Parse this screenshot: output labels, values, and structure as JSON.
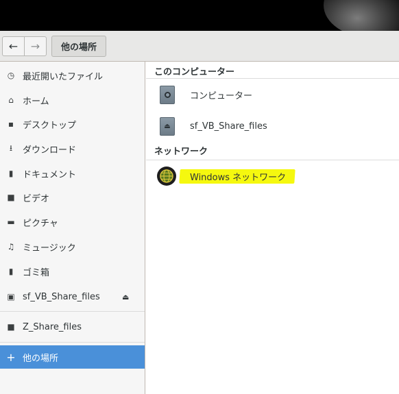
{
  "toolbar": {
    "back_icon": "←",
    "forward_icon": "→",
    "path_label": "他の場所"
  },
  "sidebar": {
    "items": [
      {
        "label": "最近開いたファイル",
        "icon": "clock-icon",
        "glyph": "◷"
      },
      {
        "label": "ホーム",
        "icon": "home-icon",
        "glyph": "⌂"
      },
      {
        "label": "デスクトップ",
        "icon": "desktop-icon",
        "glyph": "▪"
      },
      {
        "label": "ダウンロード",
        "icon": "download-icon",
        "glyph": "⭳"
      },
      {
        "label": "ドキュメント",
        "icon": "document-icon",
        "glyph": "▮"
      },
      {
        "label": "ビデオ",
        "icon": "video-icon",
        "glyph": "■"
      },
      {
        "label": "ピクチャ",
        "icon": "picture-icon",
        "glyph": "▬"
      },
      {
        "label": "ミュージック",
        "icon": "music-icon",
        "glyph": "♫"
      },
      {
        "label": "ゴミ箱",
        "icon": "trash-icon",
        "glyph": "▮"
      },
      {
        "label": "sf_VB_Share_files",
        "icon": "drive-icon",
        "glyph": "▣"
      },
      {
        "label": "Z_Share_files",
        "icon": "folder-icon",
        "glyph": "■"
      },
      {
        "label": "他の場所",
        "icon": "plus-icon",
        "glyph": "+"
      }
    ],
    "eject_glyph": "⏏"
  },
  "main": {
    "section_computer": "このコンピューター",
    "computer_label": "コンピューター",
    "share_label": "sf_VB_Share_files",
    "section_network": "ネットワーク",
    "network_label": "Windows ネットワーク"
  },
  "colors": {
    "accent": "#4a90d9",
    "highlight": "#f5f80f",
    "sidebar_bg": "#f6f6f6",
    "toolbar_bg": "#e8e8e7"
  }
}
